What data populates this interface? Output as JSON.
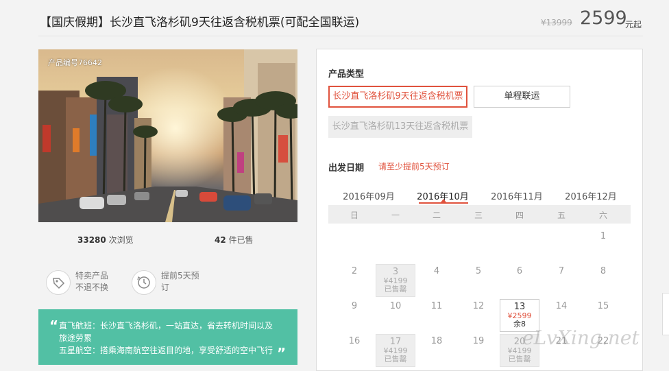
{
  "header": {
    "title": "【国庆假期】长沙直飞洛杉矶9天往返含税机票(可配全国联运)",
    "original_price": "¥13999",
    "price": "2599",
    "price_unit": "元起"
  },
  "product": {
    "code_label": "产品编号76642",
    "views_count": "33280",
    "views_label": "次浏览",
    "sold_count": "42",
    "sold_label": "件已售",
    "features": [
      {
        "icon": "tag-icon",
        "line1": "特卖产品",
        "line2": "不退不换"
      },
      {
        "icon": "clock-icon",
        "line1": "提前5天预",
        "line2": "订"
      }
    ],
    "note": {
      "line1": "直飞航班：长沙直飞洛杉矶，一站直达，省去转机时间以及",
      "line2": "旅途劳累",
      "line3": "五星航空：搭乘海南航空往返目的地，享受舒适的空中飞行"
    }
  },
  "booking": {
    "type_label": "产品类型",
    "types": [
      {
        "label": "长沙直飞洛杉矶9天往返含税机票",
        "state": "selected"
      },
      {
        "label": "单程联运",
        "state": "normal"
      },
      {
        "label": "长沙直飞洛杉矶13天往返含税机票",
        "state": "disabled"
      }
    ],
    "date_label": "出发日期",
    "date_hint": "请至少提前5天预订",
    "months": [
      "2016年09月",
      "2016年10月",
      "2016年11月",
      "2016年12月"
    ],
    "active_month": "2016年10月",
    "weekdays": [
      "日",
      "一",
      "二",
      "三",
      "四",
      "五",
      "六"
    ],
    "days": [
      {
        "day": "1",
        "col": 6,
        "row": 0
      },
      {
        "day": "2",
        "col": 0,
        "row": 1
      },
      {
        "day": "3",
        "col": 1,
        "row": 1,
        "state": "soldout",
        "price": "¥4199",
        "status": "已售罄"
      },
      {
        "day": "4",
        "col": 2,
        "row": 1
      },
      {
        "day": "5",
        "col": 3,
        "row": 1
      },
      {
        "day": "6",
        "col": 4,
        "row": 1
      },
      {
        "day": "7",
        "col": 5,
        "row": 1
      },
      {
        "day": "8",
        "col": 6,
        "row": 1
      },
      {
        "day": "9",
        "col": 0,
        "row": 2
      },
      {
        "day": "10",
        "col": 1,
        "row": 2
      },
      {
        "day": "11",
        "col": 2,
        "row": 2
      },
      {
        "day": "12",
        "col": 3,
        "row": 2
      },
      {
        "day": "13",
        "col": 4,
        "row": 2,
        "state": "avail",
        "price": "¥2599",
        "status": "余8"
      },
      {
        "day": "14",
        "col": 5,
        "row": 2
      },
      {
        "day": "15",
        "col": 6,
        "row": 2
      },
      {
        "day": "16",
        "col": 0,
        "row": 3
      },
      {
        "day": "17",
        "col": 1,
        "row": 3,
        "state": "soldout",
        "price": "¥4199",
        "status": "已售罄"
      },
      {
        "day": "18",
        "col": 2,
        "row": 3
      },
      {
        "day": "19",
        "col": 3,
        "row": 3
      },
      {
        "day": "20",
        "col": 4,
        "row": 3,
        "state": "soldout",
        "price": "¥4199",
        "status": "已售罄"
      },
      {
        "day": "21",
        "col": 5,
        "row": 3
      },
      {
        "day": "22",
        "col": 6,
        "row": 3
      }
    ]
  },
  "watermark": "eLvXing.net",
  "colors": {
    "accent": "#e0523d",
    "note_bg": "#52c0a4"
  }
}
